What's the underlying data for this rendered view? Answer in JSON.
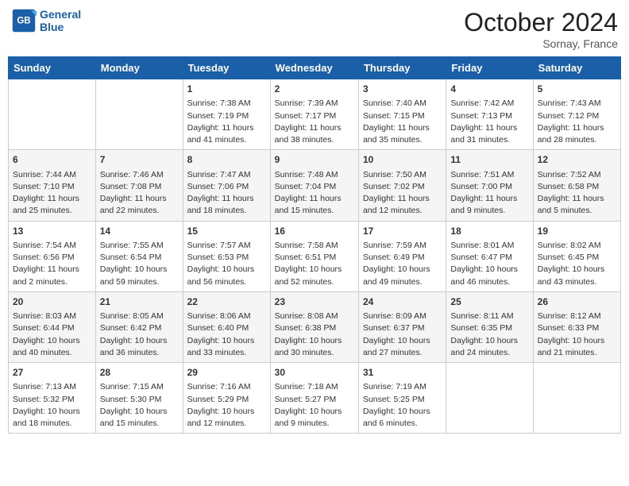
{
  "header": {
    "logo_line1": "General",
    "logo_line2": "Blue",
    "month": "October 2024",
    "location": "Sornay, France"
  },
  "days_of_week": [
    "Sunday",
    "Monday",
    "Tuesday",
    "Wednesday",
    "Thursday",
    "Friday",
    "Saturday"
  ],
  "weeks": [
    [
      {
        "day": "",
        "sunrise": "",
        "sunset": "",
        "daylight": ""
      },
      {
        "day": "",
        "sunrise": "",
        "sunset": "",
        "daylight": ""
      },
      {
        "day": "1",
        "sunrise": "Sunrise: 7:38 AM",
        "sunset": "Sunset: 7:19 PM",
        "daylight": "Daylight: 11 hours and 41 minutes."
      },
      {
        "day": "2",
        "sunrise": "Sunrise: 7:39 AM",
        "sunset": "Sunset: 7:17 PM",
        "daylight": "Daylight: 11 hours and 38 minutes."
      },
      {
        "day": "3",
        "sunrise": "Sunrise: 7:40 AM",
        "sunset": "Sunset: 7:15 PM",
        "daylight": "Daylight: 11 hours and 35 minutes."
      },
      {
        "day": "4",
        "sunrise": "Sunrise: 7:42 AM",
        "sunset": "Sunset: 7:13 PM",
        "daylight": "Daylight: 11 hours and 31 minutes."
      },
      {
        "day": "5",
        "sunrise": "Sunrise: 7:43 AM",
        "sunset": "Sunset: 7:12 PM",
        "daylight": "Daylight: 11 hours and 28 minutes."
      }
    ],
    [
      {
        "day": "6",
        "sunrise": "Sunrise: 7:44 AM",
        "sunset": "Sunset: 7:10 PM",
        "daylight": "Daylight: 11 hours and 25 minutes."
      },
      {
        "day": "7",
        "sunrise": "Sunrise: 7:46 AM",
        "sunset": "Sunset: 7:08 PM",
        "daylight": "Daylight: 11 hours and 22 minutes."
      },
      {
        "day": "8",
        "sunrise": "Sunrise: 7:47 AM",
        "sunset": "Sunset: 7:06 PM",
        "daylight": "Daylight: 11 hours and 18 minutes."
      },
      {
        "day": "9",
        "sunrise": "Sunrise: 7:48 AM",
        "sunset": "Sunset: 7:04 PM",
        "daylight": "Daylight: 11 hours and 15 minutes."
      },
      {
        "day": "10",
        "sunrise": "Sunrise: 7:50 AM",
        "sunset": "Sunset: 7:02 PM",
        "daylight": "Daylight: 11 hours and 12 minutes."
      },
      {
        "day": "11",
        "sunrise": "Sunrise: 7:51 AM",
        "sunset": "Sunset: 7:00 PM",
        "daylight": "Daylight: 11 hours and 9 minutes."
      },
      {
        "day": "12",
        "sunrise": "Sunrise: 7:52 AM",
        "sunset": "Sunset: 6:58 PM",
        "daylight": "Daylight: 11 hours and 5 minutes."
      }
    ],
    [
      {
        "day": "13",
        "sunrise": "Sunrise: 7:54 AM",
        "sunset": "Sunset: 6:56 PM",
        "daylight": "Daylight: 11 hours and 2 minutes."
      },
      {
        "day": "14",
        "sunrise": "Sunrise: 7:55 AM",
        "sunset": "Sunset: 6:54 PM",
        "daylight": "Daylight: 10 hours and 59 minutes."
      },
      {
        "day": "15",
        "sunrise": "Sunrise: 7:57 AM",
        "sunset": "Sunset: 6:53 PM",
        "daylight": "Daylight: 10 hours and 56 minutes."
      },
      {
        "day": "16",
        "sunrise": "Sunrise: 7:58 AM",
        "sunset": "Sunset: 6:51 PM",
        "daylight": "Daylight: 10 hours and 52 minutes."
      },
      {
        "day": "17",
        "sunrise": "Sunrise: 7:59 AM",
        "sunset": "Sunset: 6:49 PM",
        "daylight": "Daylight: 10 hours and 49 minutes."
      },
      {
        "day": "18",
        "sunrise": "Sunrise: 8:01 AM",
        "sunset": "Sunset: 6:47 PM",
        "daylight": "Daylight: 10 hours and 46 minutes."
      },
      {
        "day": "19",
        "sunrise": "Sunrise: 8:02 AM",
        "sunset": "Sunset: 6:45 PM",
        "daylight": "Daylight: 10 hours and 43 minutes."
      }
    ],
    [
      {
        "day": "20",
        "sunrise": "Sunrise: 8:03 AM",
        "sunset": "Sunset: 6:44 PM",
        "daylight": "Daylight: 10 hours and 40 minutes."
      },
      {
        "day": "21",
        "sunrise": "Sunrise: 8:05 AM",
        "sunset": "Sunset: 6:42 PM",
        "daylight": "Daylight: 10 hours and 36 minutes."
      },
      {
        "day": "22",
        "sunrise": "Sunrise: 8:06 AM",
        "sunset": "Sunset: 6:40 PM",
        "daylight": "Daylight: 10 hours and 33 minutes."
      },
      {
        "day": "23",
        "sunrise": "Sunrise: 8:08 AM",
        "sunset": "Sunset: 6:38 PM",
        "daylight": "Daylight: 10 hours and 30 minutes."
      },
      {
        "day": "24",
        "sunrise": "Sunrise: 8:09 AM",
        "sunset": "Sunset: 6:37 PM",
        "daylight": "Daylight: 10 hours and 27 minutes."
      },
      {
        "day": "25",
        "sunrise": "Sunrise: 8:11 AM",
        "sunset": "Sunset: 6:35 PM",
        "daylight": "Daylight: 10 hours and 24 minutes."
      },
      {
        "day": "26",
        "sunrise": "Sunrise: 8:12 AM",
        "sunset": "Sunset: 6:33 PM",
        "daylight": "Daylight: 10 hours and 21 minutes."
      }
    ],
    [
      {
        "day": "27",
        "sunrise": "Sunrise: 7:13 AM",
        "sunset": "Sunset: 5:32 PM",
        "daylight": "Daylight: 10 hours and 18 minutes."
      },
      {
        "day": "28",
        "sunrise": "Sunrise: 7:15 AM",
        "sunset": "Sunset: 5:30 PM",
        "daylight": "Daylight: 10 hours and 15 minutes."
      },
      {
        "day": "29",
        "sunrise": "Sunrise: 7:16 AM",
        "sunset": "Sunset: 5:29 PM",
        "daylight": "Daylight: 10 hours and 12 minutes."
      },
      {
        "day": "30",
        "sunrise": "Sunrise: 7:18 AM",
        "sunset": "Sunset: 5:27 PM",
        "daylight": "Daylight: 10 hours and 9 minutes."
      },
      {
        "day": "31",
        "sunrise": "Sunrise: 7:19 AM",
        "sunset": "Sunset: 5:25 PM",
        "daylight": "Daylight: 10 hours and 6 minutes."
      },
      {
        "day": "",
        "sunrise": "",
        "sunset": "",
        "daylight": ""
      },
      {
        "day": "",
        "sunrise": "",
        "sunset": "",
        "daylight": ""
      }
    ]
  ]
}
